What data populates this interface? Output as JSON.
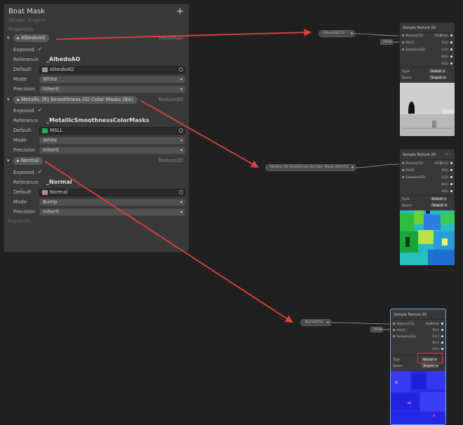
{
  "blackboard": {
    "title": "Boat Mask",
    "subtitle": "Shader Graphs",
    "add_symbol": "+",
    "properties_label": "Properties",
    "keywords_label": "Keywords",
    "expand_glyph": "▾",
    "check_glyph": "✓",
    "chevron_glyph": "▾",
    "properties": [
      {
        "name": "AlbedoAO",
        "type": "Texture2D",
        "exposed_label": "Exposed",
        "reference_label": "Reference",
        "reference": "_AlbedoAO",
        "default_label": "Default",
        "default_texture": "AlbedoAO",
        "mode_label": "Mode",
        "mode": "White",
        "precision_label": "Precision",
        "precision": "Inherit"
      },
      {
        "name": "Metallic (R) Smoothness (G) Color Masks (BA)",
        "type": "Texture2D",
        "exposed_label": "Exposed",
        "reference_label": "Reference",
        "reference": "_MetallicSmoothnessColorMasks",
        "default_label": "Default",
        "default_texture": "MSLL",
        "mode_label": "Mode",
        "mode": "White",
        "precision_label": "Precision",
        "precision": "Inherit"
      },
      {
        "name": "Normal",
        "type": "Texture2D",
        "exposed_label": "Exposed",
        "reference_label": "Reference",
        "reference": "_Normal",
        "default_label": "Default",
        "default_texture": "Normal",
        "mode_label": "Mode",
        "mode": "Bump",
        "precision_label": "Precision",
        "precision": "Inherit"
      }
    ]
  },
  "graph": {
    "property_nodes": [
      {
        "label": "AlbedoAO(T2)"
      },
      {
        "label": "Metallic (R) Smoothness (G) Color Masks (BA)(T2)"
      },
      {
        "label": "Normal(T2)"
      }
    ],
    "uv_chip": "UV0",
    "sample_nodes": [
      {
        "title": "Sample Texture 2D",
        "inputs": [
          "Texture(T2)",
          "UV(2)",
          "Sampler(SS)"
        ],
        "outputs": [
          "RGBA(4)",
          "R(1)",
          "G(1)",
          "B(1)",
          "A(1)"
        ],
        "type_label": "Type",
        "type_value": "Default",
        "space_label": "Space",
        "space_value": "Tangent"
      },
      {
        "title": "Sample Texture 2D",
        "inputs": [
          "Texture(T2)",
          "UV(2)",
          "Sampler(SS)"
        ],
        "outputs": [
          "RGBA(4)",
          "R(1)",
          "G(1)",
          "B(1)",
          "A(1)"
        ],
        "type_label": "Type",
        "type_value": "Default",
        "space_label": "Space",
        "space_value": "Tangent"
      },
      {
        "title": "Sample Texture 2D",
        "inputs": [
          "Texture(T2)",
          "UV(2)",
          "Sampler(SS)"
        ],
        "outputs": [
          "RGBA(4)",
          "R(1)",
          "G(1)",
          "B(1)",
          "A(1)"
        ],
        "type_label": "Type",
        "type_value": "Normal",
        "space_label": "Space",
        "space_value": "Tangent"
      }
    ]
  },
  "colors": {
    "annotation_arrow": "#e0403c",
    "thumb_albedo": "#8a9aa0",
    "thumb_msll": "#27b04a",
    "thumb_normal": "#b98a8a"
  }
}
